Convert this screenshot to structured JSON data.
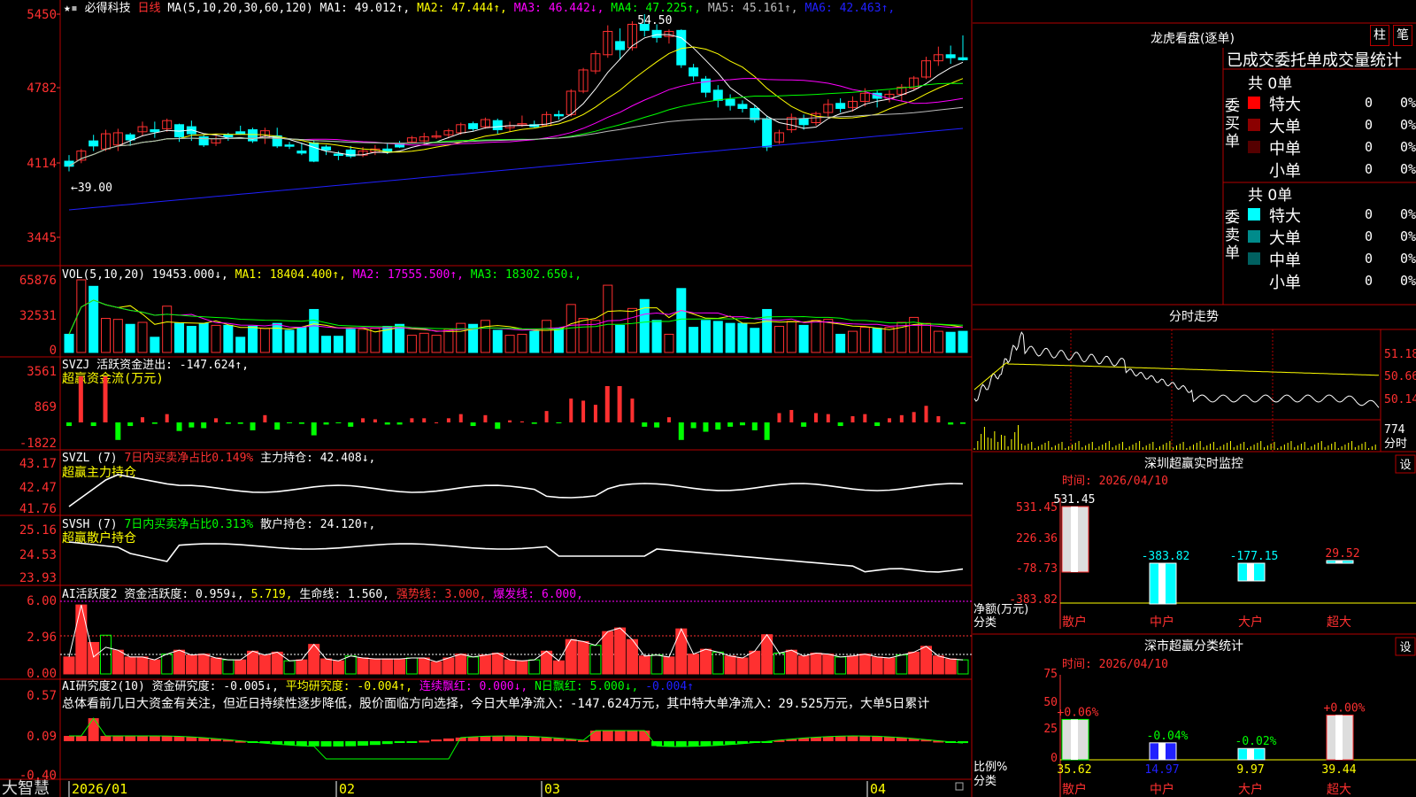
{
  "header": {
    "stock": "必得科技",
    "period": "日线",
    "ma_title": "MA(5,10,20,30,60,120)",
    "ma": [
      {
        "name": "MA1:",
        "value": "49.012↑",
        "color": "#ffffff"
      },
      {
        "name": "MA2:",
        "value": "47.444↑",
        "color": "#ffff00"
      },
      {
        "name": "MA3:",
        "value": "46.442↓",
        "color": "#ff00ff"
      },
      {
        "name": "MA4:",
        "value": "47.225↑",
        "color": "#00ff00"
      },
      {
        "name": "MA5:",
        "value": "45.161↑",
        "color": "#bbbbbb"
      },
      {
        "name": "MA6:",
        "value": "42.463↑",
        "color": "#2020ff"
      }
    ]
  },
  "chart_data": [
    {
      "type": "candlestick",
      "yticks": [
        "5450",
        "4782",
        "4114",
        "3445"
      ],
      "ylim": [
        32.0,
        55.0
      ],
      "annotations": [
        {
          "text": "54.50"
        },
        {
          "text": "←39.00"
        }
      ],
      "candles": [
        [
          40.0,
          39.5,
          40.6,
          39.0
        ],
        [
          40.1,
          41.0,
          41.2,
          39.8
        ],
        [
          42.0,
          41.5,
          42.6,
          41.0
        ],
        [
          41.2,
          42.7,
          43.1,
          41.0
        ],
        [
          41.6,
          42.8,
          43.2,
          41.0
        ],
        [
          42.6,
          42.1,
          42.8,
          41.5
        ],
        [
          42.9,
          43.4,
          43.9,
          42.5
        ],
        [
          43.1,
          42.9,
          43.9,
          42.3
        ],
        [
          43.2,
          44.0,
          44.2,
          42.9
        ],
        [
          43.6,
          42.4,
          43.7,
          41.9
        ],
        [
          43.4,
          42.7,
          44.0,
          42.0
        ],
        [
          42.4,
          41.6,
          42.6,
          41.4
        ],
        [
          41.8,
          42.2,
          42.5,
          41.5
        ],
        [
          42.6,
          42.4,
          42.8,
          42.0
        ],
        [
          42.9,
          42.7,
          43.5,
          42.6
        ],
        [
          43.1,
          42.0,
          43.3,
          41.8
        ],
        [
          42.3,
          43.0,
          43.3,
          41.7
        ],
        [
          42.5,
          41.5,
          43.3,
          41.3
        ],
        [
          41.6,
          41.5,
          41.9,
          41.2
        ],
        [
          41.0,
          40.8,
          41.8,
          40.6
        ],
        [
          41.8,
          40.0,
          42.0,
          39.9
        ],
        [
          41.4,
          41.1,
          41.6,
          40.6
        ],
        [
          40.7,
          40.6,
          41.0,
          40.1
        ],
        [
          41.1,
          40.5,
          41.5,
          40.3
        ],
        [
          40.6,
          41.0,
          41.4,
          40.4
        ],
        [
          40.9,
          41.2,
          41.6,
          40.6
        ],
        [
          41.2,
          40.9,
          41.8,
          40.7
        ],
        [
          41.7,
          41.4,
          42.0,
          41.3
        ],
        [
          41.9,
          42.3,
          42.5,
          41.8
        ],
        [
          42.0,
          42.4,
          42.8,
          41.7
        ],
        [
          42.5,
          42.5,
          43.0,
          42.2
        ],
        [
          42.6,
          43.0,
          43.2,
          42.3
        ],
        [
          42.8,
          43.6,
          43.8,
          42.6
        ],
        [
          43.7,
          43.2,
          43.9,
          43.0
        ],
        [
          43.4,
          44.1,
          44.3,
          43.2
        ],
        [
          44.0,
          43.1,
          44.2,
          42.7
        ],
        [
          43.3,
          43.5,
          43.9,
          42.9
        ],
        [
          43.6,
          43.7,
          44.5,
          43.4
        ],
        [
          43.6,
          43.4,
          44.0,
          43.3
        ],
        [
          43.5,
          44.6,
          44.9,
          43.4
        ],
        [
          44.6,
          44.5,
          45.0,
          44.1
        ],
        [
          44.6,
          46.9,
          47.1,
          44.4
        ],
        [
          46.9,
          49.0,
          49.2,
          46.7
        ],
        [
          48.9,
          50.6,
          50.9,
          48.6
        ],
        [
          50.5,
          52.8,
          53.4,
          50.2
        ],
        [
          51.8,
          51.0,
          53.1,
          50.0
        ],
        [
          51.2,
          53.5,
          53.8,
          50.9
        ],
        [
          53.5,
          52.9,
          54.5,
          52.3
        ],
        [
          52.9,
          52.2,
          53.5,
          51.7
        ],
        [
          52.3,
          52.8,
          53.0,
          51.6
        ],
        [
          52.9,
          49.5,
          53.0,
          49.2
        ],
        [
          49.2,
          48.4,
          49.6,
          47.9
        ],
        [
          48.1,
          46.8,
          48.4,
          46.3
        ],
        [
          47.0,
          46.0,
          47.5,
          45.3
        ],
        [
          46.1,
          45.5,
          46.6,
          45.0
        ],
        [
          45.6,
          45.2,
          46.0,
          44.8
        ],
        [
          45.2,
          44.1,
          45.5,
          43.8
        ],
        [
          44.2,
          41.4,
          44.5,
          41.0
        ],
        [
          41.9,
          42.8,
          43.1,
          41.7
        ],
        [
          43.1,
          44.3,
          44.7,
          42.8
        ],
        [
          44.2,
          43.6,
          44.6,
          43.1
        ],
        [
          43.8,
          44.7,
          44.9,
          43.5
        ],
        [
          44.8,
          45.6,
          46.1,
          44.4
        ],
        [
          45.7,
          45.2,
          46.2,
          44.8
        ],
        [
          45.3,
          45.9,
          46.4,
          44.9
        ],
        [
          45.9,
          46.7,
          47.2,
          45.4
        ],
        [
          46.7,
          46.2,
          47.0,
          45.3
        ],
        [
          46.2,
          46.6,
          47.0,
          45.8
        ],
        [
          46.6,
          47.3,
          47.6,
          45.9
        ],
        [
          47.2,
          48.2,
          48.4,
          47.0
        ],
        [
          48.3,
          49.9,
          50.3,
          48.1
        ],
        [
          49.9,
          50.5,
          51.3,
          49.4
        ],
        [
          50.5,
          50.2,
          51.4,
          49.6
        ],
        [
          50.2,
          50.0,
          52.4,
          49.9
        ]
      ]
    },
    {
      "type": "bar",
      "title": "VOL(5,10,20)",
      "current": "19453.000↓",
      "ma": [
        {
          "name": "MA1:",
          "value": "18404.400↑"
        },
        {
          "name": "MA2:",
          "value": "17555.500↑"
        },
        {
          "name": "MA3:",
          "value": "18302.650↓"
        }
      ],
      "yticks": [
        "65876",
        "32531",
        "0"
      ],
      "ylim": [
        0,
        65876
      ]
    },
    {
      "type": "bar",
      "title": "SVZJ",
      "name": "活跃资金进出:",
      "value": "-147.624↑,",
      "subtitle": "超赢资金流(万元)",
      "yticks": [
        "3561",
        "869",
        "-1822"
      ]
    },
    {
      "type": "line",
      "title": "SVZL (7)",
      "desc": "7日内买卖净占比0.149%",
      "name": "主力持仓:",
      "value": "42.408↓,",
      "subtitle": "超赢主力持仓",
      "yticks": [
        "43.17",
        "42.47",
        "41.76"
      ]
    },
    {
      "type": "line",
      "title": "SVSH (7)",
      "desc": "7日内买卖净占比0.313%",
      "name": "散户持仓:",
      "value": "24.120↑,",
      "subtitle": "超赢散户持仓",
      "yticks": [
        "25.16",
        "24.53",
        "23.93"
      ]
    },
    {
      "type": "bar",
      "title": "AI活跃度2",
      "items": [
        {
          "text": "资金活跃度: 0.959↓,",
          "color": "#ffffff"
        },
        {
          "text": "5.719,",
          "color": "#ffff00"
        },
        {
          "text": "生命线: 1.560,",
          "color": "#ffffff"
        },
        {
          "text": "强势线: 3.000,",
          "color": "#ff3030"
        },
        {
          "text": "爆发线: 6.000,",
          "color": "#ff00ff"
        }
      ],
      "yticks": [
        "6.00",
        "2.96",
        "0.00"
      ]
    },
    {
      "type": "bar",
      "title": "AI研究度2(10)",
      "items": [
        {
          "text": "资金研究度: -0.005↓,",
          "color": "#ffffff"
        },
        {
          "text": "平均研究度: -0.004↑,",
          "color": "#ffff00"
        },
        {
          "text": "连续飘红: 0.000↓,",
          "color": "#ff00ff"
        },
        {
          "text": "N日飘红: 5.000↓,",
          "color": "#00ff00"
        },
        {
          "text": "-0.004↑",
          "color": "#2020ff"
        }
      ],
      "commentary": "总体看前几日大资金有关注，但近日持续性逐步降低，股价面临方向选择，今日大单净流入：-147.624万元，其中特大单净流入：29.525万元，大单5日累计",
      "yticks": [
        "0.57",
        "0.09",
        "-0.40"
      ]
    },
    {
      "type": "line",
      "title": "分时走势",
      "yticks": [
        "51.18",
        "50.66",
        "50.14"
      ],
      "vol_label": "774",
      "foot_label": "分时"
    },
    {
      "type": "bar",
      "title": "深圳超赢实时监控",
      "time": "时间: 2026/04/10",
      "categories": [
        "散户",
        "中户",
        "大户",
        "超大"
      ],
      "values": [
        531.45,
        -383.82,
        -177.15,
        29.52
      ],
      "value_labels": [
        "531.45",
        "-383.82",
        "-177.15",
        "29.52"
      ],
      "yticks": [
        "531.45",
        "226.36",
        "-78.73",
        "-383.82"
      ],
      "ylim": [
        -383.82,
        531.45
      ],
      "ylabel": "净额(万元)",
      "xlabel": "分类",
      "settings_button": "设"
    },
    {
      "type": "bar",
      "title": "深市超赢分类统计",
      "time": "时间: 2026/04/10",
      "categories": [
        "散户",
        "中户",
        "大户",
        "超大"
      ],
      "values": [
        35.62,
        14.97,
        9.97,
        39.44
      ],
      "value_labels": [
        "35.62",
        "14.97",
        "9.97",
        "39.44"
      ],
      "change_labels": [
        "+0.06%",
        "-0.04%",
        "-0.02%",
        "+0.00%"
      ],
      "yticks": [
        "75",
        "50",
        "25",
        "0"
      ],
      "ylim": [
        0,
        75
      ],
      "ylabel": "比例%",
      "xlabel": "分类",
      "settings_button": "设"
    }
  ],
  "footer": {
    "brand": "大智慧",
    "dates": [
      "2026/01",
      "02",
      "03",
      "04"
    ]
  },
  "dragon": {
    "title": "龙虎看盘(逐单)",
    "btn1": "柱",
    "btn2": "笔",
    "header": "已成交委托单成交量统计",
    "buy": {
      "group": "委买单",
      "total": "共 0单",
      "rows": [
        {
          "name": "特大",
          "count": "0",
          "pct": "0%",
          "color": "#ff0000"
        },
        {
          "name": "大单",
          "count": "0",
          "pct": "0%",
          "color": "#8b0000"
        },
        {
          "name": "中单",
          "count": "0",
          "pct": "0%",
          "color": "#550000"
        },
        {
          "name": "小单",
          "count": "0",
          "pct": "0%",
          "color": "#000000"
        }
      ]
    },
    "sell": {
      "group": "委卖单",
      "total": "共 0单",
      "rows": [
        {
          "name": "特大",
          "count": "0",
          "pct": "0%",
          "color": "#00ffff"
        },
        {
          "name": "大单",
          "count": "0",
          "pct": "0%",
          "color": "#008b8b"
        },
        {
          "name": "中单",
          "count": "0",
          "pct": "0%",
          "color": "#006060"
        },
        {
          "name": "小单",
          "count": "0",
          "pct": "0%",
          "color": "#000000"
        }
      ]
    }
  }
}
